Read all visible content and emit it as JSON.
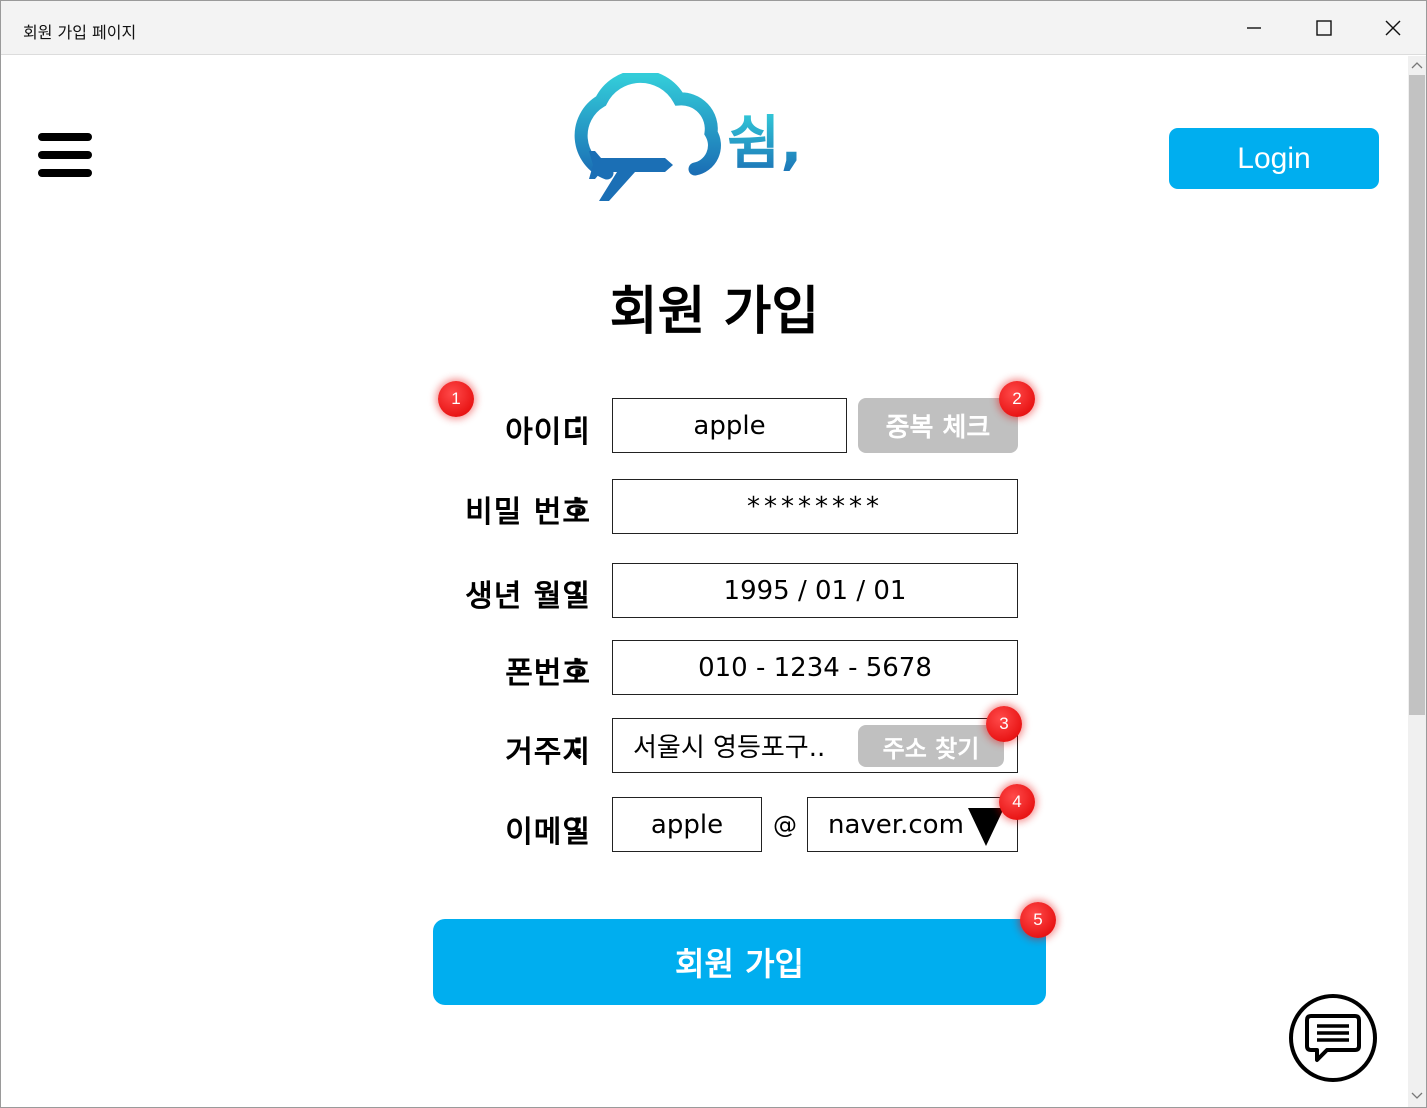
{
  "window": {
    "title": "회원 가입 페이지"
  },
  "header": {
    "logo_text": "쉼,",
    "login_label": "Login"
  },
  "page": {
    "title": "회원 가입"
  },
  "form": {
    "id_label": "아이디",
    "id_value": "apple",
    "dup_check_label": "중복 체크",
    "pw_label": "비밀 번호",
    "pw_value": "********",
    "birth_label": "생년 월일",
    "birth_value": "1995 / 01 / 01",
    "phone_label": "폰번호",
    "phone_value": "010 - 1234 - 5678",
    "address_label": "거주지",
    "address_value": "서울시 영등포구..",
    "address_search_label": "주소 찾기",
    "email_label": "이메일",
    "email_local": "apple",
    "email_at": "@",
    "email_domain": "naver.com",
    "colon": ":",
    "submit_label": "회원 가입"
  },
  "badges": [
    "1",
    "2",
    "3",
    "4",
    "5"
  ],
  "colors": {
    "accent": "#00aeef",
    "disabled": "#c0c0c0",
    "badge": "#e00000"
  },
  "icons": {
    "menu": "hamburger-icon",
    "chat": "chat-icon",
    "dropdown": "triangle-down-icon"
  }
}
